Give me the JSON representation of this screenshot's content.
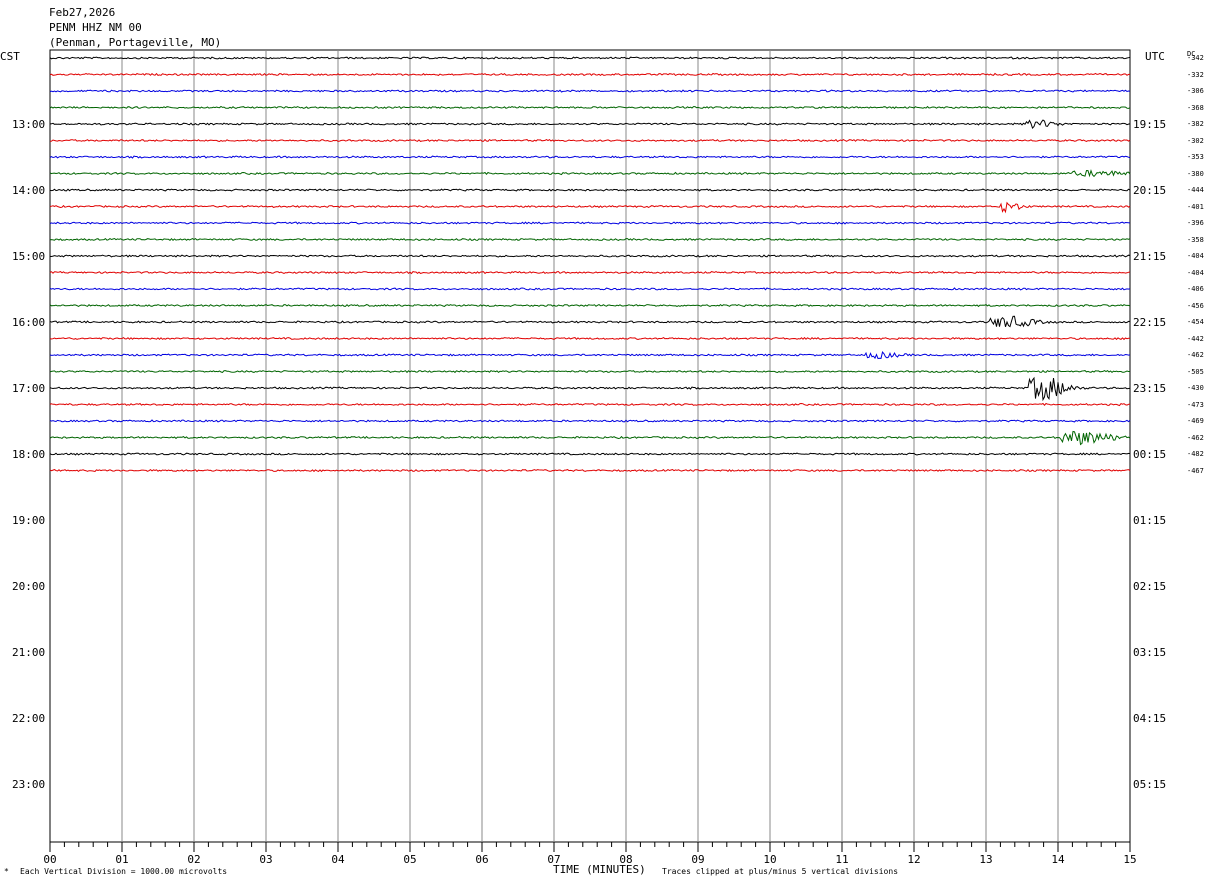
{
  "header": {
    "date": "Feb27,2026",
    "station": "PENM HHZ NM 00",
    "location": "(Penman, Portageville, MO)"
  },
  "left_zone_label": "CST",
  "right_zone_label": "UTC",
  "dc_label": "DC",
  "footer": {
    "scale_note": "Each Vertical Division = 1000.00 microvolts",
    "clip_note": "Traces clipped at plus/minus 5 vertical divisions"
  },
  "chart_data": {
    "type": "line",
    "title": "",
    "xlabel": "TIME (MINUTES)",
    "x_ticks": [
      "00",
      "01",
      "02",
      "03",
      "04",
      "05",
      "06",
      "07",
      "08",
      "09",
      "10",
      "11",
      "12",
      "13",
      "14",
      "15"
    ],
    "xlim": [
      0,
      15
    ],
    "grid": true,
    "rows_per_hour": 4,
    "hour_labels_left": [
      "13:00",
      "14:00",
      "15:00",
      "16:00",
      "17:00",
      "18:00",
      "19:00",
      "20:00",
      "21:00",
      "22:00",
      "23:00"
    ],
    "hour_labels_right": [
      "19:15",
      "20:15",
      "21:15",
      "22:15",
      "23:15",
      "00:15",
      "01:15",
      "02:15",
      "03:15",
      "04:15",
      "05:15"
    ],
    "trace_colors": [
      "#000000",
      "#e00000",
      "#0000e0",
      "#006400"
    ],
    "dc_offsets": [
      "-342",
      "-332",
      "-306",
      "-368",
      "-382",
      "-302",
      "-353",
      "-380",
      "-444",
      "-401",
      "-396",
      "-358",
      "-404",
      "-404",
      "-406",
      "-456",
      "-454",
      "-442",
      "-462",
      "-505",
      "-430",
      "-473",
      "-469",
      "-462",
      "-482",
      "-467"
    ],
    "events": [
      {
        "row": 4,
        "minute": 13.7,
        "amplitude": 0.45,
        "duration_min": 0.6
      },
      {
        "row": 7,
        "minute": 14.5,
        "amplitude": 0.3,
        "duration_min": 1.0
      },
      {
        "row": 9,
        "minute": 13.3,
        "amplitude": 0.6,
        "duration_min": 0.4
      },
      {
        "row": 16,
        "minute": 13.3,
        "amplitude": 0.65,
        "duration_min": 0.8
      },
      {
        "row": 18,
        "minute": 11.5,
        "amplitude": 0.35,
        "duration_min": 0.6
      },
      {
        "row": 20,
        "minute": 13.8,
        "amplitude": 1.4,
        "duration_min": 0.7
      },
      {
        "row": 23,
        "minute": 14.3,
        "amplitude": 0.8,
        "duration_min": 1.0
      }
    ]
  }
}
